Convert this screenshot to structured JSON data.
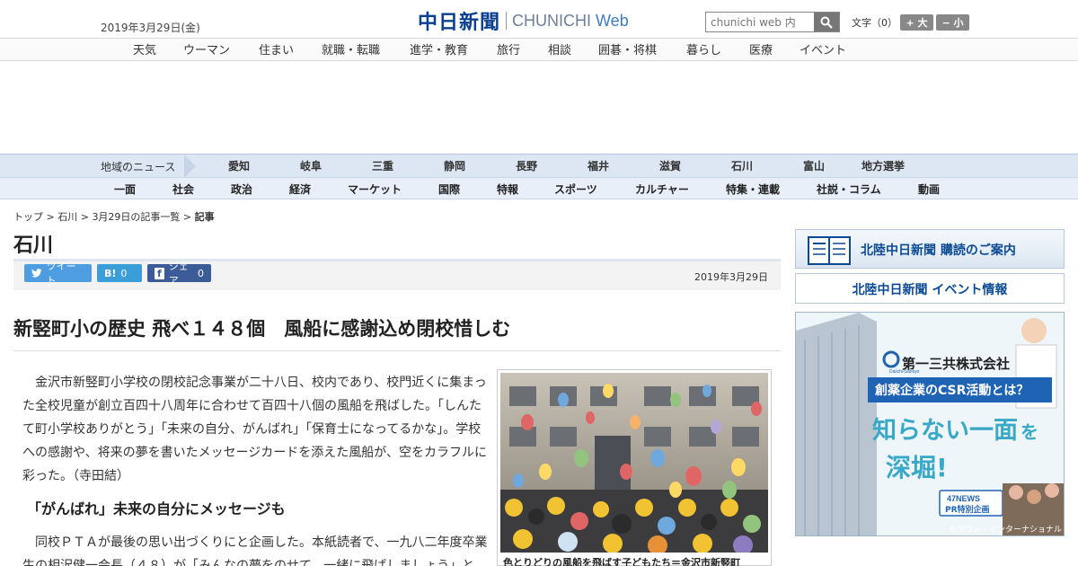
{
  "header": {
    "date": "2019年3月29日(金)",
    "logo_kanji": "中日新聞",
    "logo_roman": "CHUNICHI",
    "logo_web": "Web",
    "search_placeholder": "chunichi web 内",
    "font_size_label": "文字（0）",
    "font_plus": "+ 大",
    "font_minus": "− 小"
  },
  "nav_top": [
    "天気",
    "ウーマン",
    "住まい",
    "就職・転職",
    "進学・教育",
    "旅行",
    "相談",
    "囲碁・将棋",
    "暮らし",
    "医療",
    "イベント"
  ],
  "region": {
    "label": "地域のニュース",
    "items": [
      "愛知",
      "岐阜",
      "三重",
      "静岡",
      "長野",
      "福井",
      "滋賀",
      "石川",
      "富山",
      "地方選挙"
    ]
  },
  "categories": [
    "一面",
    "社会",
    "政治",
    "経済",
    "マーケット",
    "国際",
    "特報",
    "スポーツ",
    "カルチャー",
    "特集・連載",
    "社説・コラム",
    "動画"
  ],
  "breadcrumb": {
    "top": "トップ",
    "pref": "石川",
    "list": "3月29日の記事一覧",
    "current": "記事"
  },
  "section_title": "石川",
  "share": {
    "tweet": "ツイート",
    "hatena_label": "B!",
    "hatena_count": "0",
    "facebook": "シェア",
    "facebook_count": "0"
  },
  "article": {
    "date": "2019年3月29日",
    "headline": "新竪町小の歴史 飛べ１４８個　風船に感謝込め閉校惜しむ",
    "lead": "金沢市新竪町小学校の閉校記念事業が二十八日、校内であり、校門近くに集まった全校児童が創立百四十八周年に合わせて百四十八個の風船を飛ばした。「しんたて町小学校ありがとう」「未来の自分、がんばれ」「保育士になってるかな」。学校への感謝や、将来の夢を書いたメッセージカードを添えた風船が、空をカラフルに彩った。（寺田結）",
    "subhead": "「がんばれ」未来の自分にメッセージも",
    "body": "同校ＰＴＡが最後の思い出づくりにと企画した。本紙読者で、一九八二年度卒業生の相沢健一会長（４８）が「みんなの夢をのせて、一緒に飛ばしましょう」と",
    "photo_caption": "色とりどりの風船を飛ばす子どもたち＝金沢市新竪町"
  },
  "sidebar": {
    "banner1": "北陸中日新聞 購読のご案内",
    "banner2": "北陸中日新聞 イベント情報",
    "ad": {
      "company": "第一三共株式会社",
      "company_small": "Daiichi-Sankyo",
      "tagline": "創薬企業のCSR活動とは？",
      "headline_1": "知らない一面",
      "headline_2": "を",
      "headline_3": "深堀!",
      "badge_1": "47NEWS",
      "badge_2": "PR特別企画",
      "credit": "©プラン・インターナショナル"
    }
  }
}
